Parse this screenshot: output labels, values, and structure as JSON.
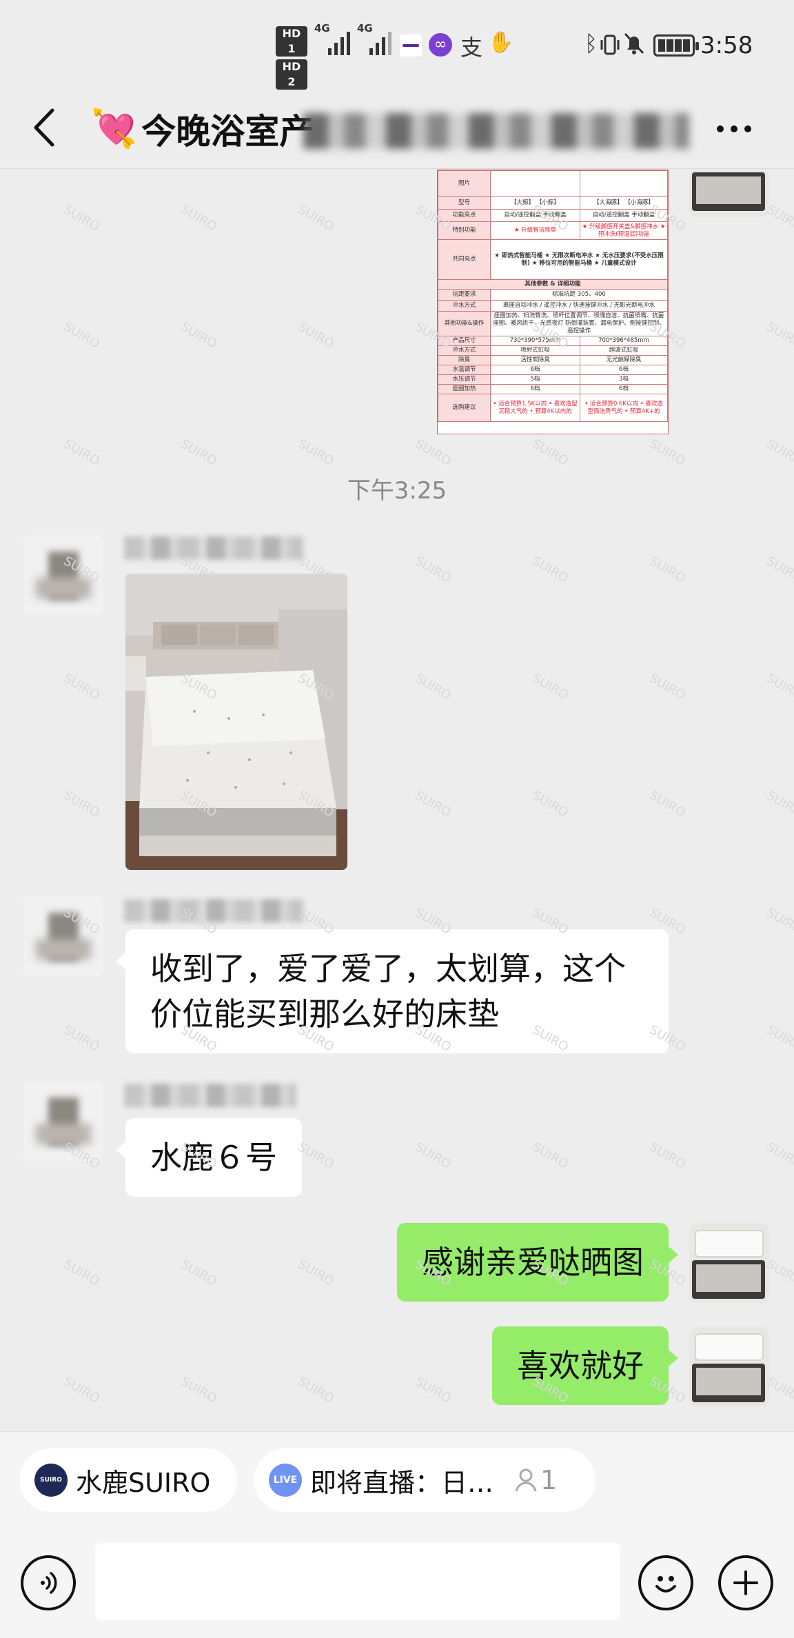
{
  "status_bar": {
    "time": "3:58",
    "hd1": "HD 1",
    "hd2": "HD 2",
    "net1": "4G",
    "net2": "4G"
  },
  "header": {
    "title": "今晚浴室产"
  },
  "product_table": {
    "rows": [
      {
        "label": "图片",
        "cells": [
          "",
          ""
        ]
      },
      {
        "label": "型号",
        "cells": [
          "【大鲸】 【小鲸】",
          "【大海豚】 【小海豚】"
        ]
      },
      {
        "label": "功能亮点",
        "cells": [
          "自动/遥控翻盖  手动翻盖",
          "自动/遥控翻盖  手动翻盖"
        ]
      },
      {
        "label": "特别功能",
        "cells": [
          "★ 升级智洁除臭",
          "★ 升级脚感开关盖&脚感冲水 ★ 预冲洗(预湿润)功能"
        ]
      },
      {
        "label": "共同亮点",
        "cells": [
          "★ 即热式智能马桶 ★ 无限次断电冲水 ★ 无水压要求(不受水压限制) ★ 移位可用的智能马桶 ★ 儿童模式设计",
          ""
        ]
      },
      {
        "label": "其他参数 & 详细功能",
        "cells": []
      },
      {
        "label": "坑距要求",
        "cells": [
          "标准坑距 305、400",
          ""
        ]
      },
      {
        "label": "冲水方式",
        "cells": [
          "离座自动冲水 / 遥控冲水 / 快速按键冲水 / 无影光断电冲水",
          ""
        ]
      },
      {
        "label": "其他功能&操作",
        "cells": [
          "座圈加热、妇洗臀洗、喷杆位置调节、喷嘴自洁、抗菌喷嘴、抗菌座圈、暖风烘干、光感夜灯 防倒灌装置、漏电保护、侧按键控制、遥控操作",
          ""
        ]
      },
      {
        "label": "产品尺寸",
        "cells": [
          "730*390*575mm",
          "700*396*485mm"
        ]
      },
      {
        "label": "冲水方式",
        "cells": [
          "喷射式虹吸",
          "超漩式虹吸"
        ]
      },
      {
        "label": "除臭",
        "cells": [
          "活性炭除臭",
          "无光触媒除臭"
        ]
      },
      {
        "label": "水温调节",
        "cells": [
          "6档",
          "6档"
        ]
      },
      {
        "label": "水压调节",
        "cells": [
          "5档",
          "3档"
        ]
      },
      {
        "label": "座圈加热",
        "cells": [
          "6档",
          "6档"
        ]
      },
      {
        "label": "选购建议",
        "cells": [
          "• 适合预算1.5K以内 • 喜欢造型沉稳大气的 • 预算4K以内的",
          "• 适合预算0.6K以内 • 喜欢造型简洁秀气的 • 预算4K+的"
        ]
      }
    ]
  },
  "messages": {
    "timestamp": "下午3:25",
    "m2": "收到了，爱了爱了，太划算，这个价位能买到那么好的床垫",
    "m3": "水鹿６号",
    "m4": "感谢亲爱哒晒图",
    "m5": "喜欢就好"
  },
  "mini_bar": {
    "chip1_logo": "SUIRO",
    "chip1_label": "水鹿SUIRO",
    "chip2_badge": "LIVE",
    "chip2_label": "即将直播：日…",
    "chip2_count": "1"
  },
  "watermark_text": "SUIRO",
  "colors": {
    "bg": "#ededed",
    "bubble_self": "#95ec69",
    "bubble_other": "#ffffff",
    "accent_red": "#e23333"
  }
}
